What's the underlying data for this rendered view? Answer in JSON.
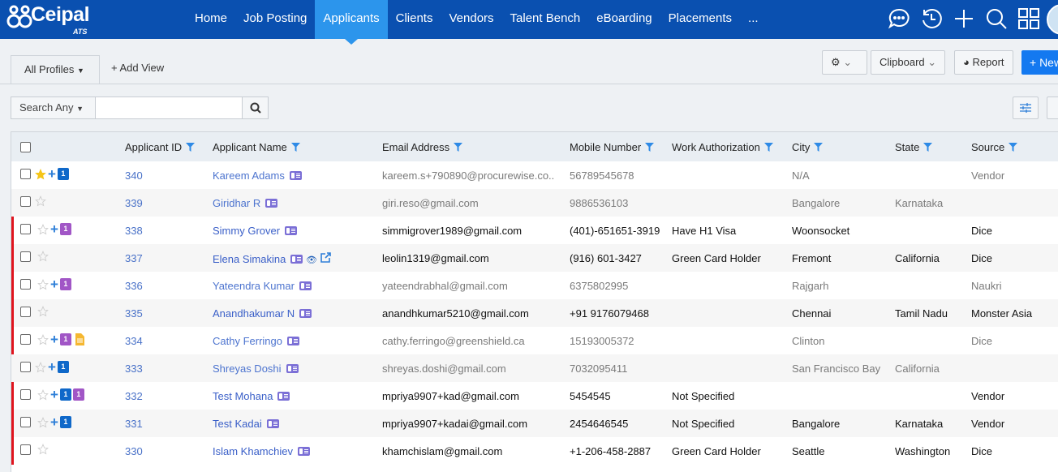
{
  "brand": {
    "name": "Ceipal",
    "sub": "ATS"
  },
  "nav": {
    "items": [
      "Home",
      "Job Posting",
      "Applicants",
      "Clients",
      "Vendors",
      "Talent Bench",
      "eBoarding",
      "Placements",
      "..."
    ],
    "active": "Applicants",
    "icons": [
      "chat-icon",
      "history-icon",
      "plus-icon",
      "search-icon",
      "apps-grid-icon"
    ]
  },
  "toolbar": {
    "tab": "All Profiles",
    "add_view": "+ Add View",
    "clipboard": "Clipboard",
    "report": "Report",
    "new": "+ New"
  },
  "search": {
    "select": "Search Any",
    "value": ""
  },
  "colors": {
    "nav": "#0a50b0",
    "active": "#2c95ec",
    "flag": "#e0141e",
    "primary": "#1479f0"
  },
  "table": {
    "columns": [
      "Applicant ID",
      "Applicant Name",
      "Email Address",
      "Mobile Number",
      "Work Authorization",
      "City",
      "State",
      "Source"
    ],
    "rows": [
      {
        "id": "340",
        "name": "Kareem Adams",
        "email": "kareem.s+790890@procurewise.co..",
        "mobile": "56789545678",
        "auth": "",
        "city": "N/A",
        "state": "",
        "source": "Vendor",
        "viewed": true,
        "flag": false,
        "star": true,
        "plus": true,
        "badges": [
          "blue"
        ]
      },
      {
        "id": "339",
        "name": "Giridhar R",
        "email": "giri.reso@gmail.com",
        "mobile": "9886536103",
        "auth": "",
        "city": "Bangalore",
        "state": "Karnataka",
        "source": "",
        "viewed": true,
        "flag": false,
        "star": false,
        "plus": false,
        "badges": []
      },
      {
        "id": "338",
        "name": "Simmy Grover",
        "email": "simmigrover1989@gmail.com",
        "mobile": "(401)-651651-3919",
        "auth": "Have H1 Visa",
        "city": "Woonsocket",
        "state": "",
        "source": "Dice",
        "viewed": false,
        "flag": true,
        "star": false,
        "plus": true,
        "badges": [
          "purple"
        ]
      },
      {
        "id": "337",
        "name": "Elena Simakina",
        "email": "leolin1319@gmail.com",
        "mobile": "(916) 601-3427",
        "auth": "Green Card Holder",
        "city": "Fremont",
        "state": "California",
        "source": "Dice",
        "viewed": false,
        "flag": true,
        "star": false,
        "plus": false,
        "badges": [],
        "extra": true
      },
      {
        "id": "336",
        "name": "Yateendra Kumar",
        "email": "yateendrabhal@gmail.com",
        "mobile": "6375802995",
        "auth": "",
        "city": "Rajgarh",
        "state": "",
        "source": "Naukri",
        "viewed": true,
        "flag": true,
        "star": false,
        "plus": true,
        "badges": [
          "purple"
        ]
      },
      {
        "id": "335",
        "name": "Anandhakumar N",
        "email": "anandhkumar5210@gmail.com",
        "mobile": "+91 9176079468",
        "auth": "",
        "city": "Chennai",
        "state": "Tamil Nadu",
        "source": "Monster Asia",
        "viewed": false,
        "flag": true,
        "star": false,
        "plus": false,
        "badges": []
      },
      {
        "id": "334",
        "name": "Cathy Ferringo",
        "email": "cathy.ferringo@greenshield.ca",
        "mobile": "15193005372",
        "auth": "",
        "city": "Clinton",
        "state": "",
        "source": "Dice",
        "viewed": true,
        "flag": true,
        "star": false,
        "plus": true,
        "badges": [
          "purple"
        ],
        "doc": true
      },
      {
        "id": "333",
        "name": "Shreyas Doshi",
        "email": "shreyas.doshi@gmail.com",
        "mobile": "7032095411",
        "auth": "",
        "city": "San Francisco Bay",
        "state": "California",
        "source": "",
        "viewed": true,
        "flag": false,
        "star": false,
        "plus": true,
        "badges": [
          "blue"
        ]
      },
      {
        "id": "332",
        "name": "Test Mohana",
        "email": "mpriya9907+kad@gmail.com",
        "mobile": "5454545",
        "auth": "Not Specified",
        "city": "",
        "state": "",
        "source": "Vendor",
        "viewed": false,
        "flag": true,
        "star": false,
        "plus": true,
        "badges": [
          "blue",
          "purple"
        ]
      },
      {
        "id": "331",
        "name": "Test Kadai",
        "email": "mpriya9907+kadai@gmail.com",
        "mobile": "2454646545",
        "auth": "Not Specified",
        "city": "Bangalore",
        "state": "Karnataka",
        "source": "Vendor",
        "viewed": false,
        "flag": true,
        "star": false,
        "plus": true,
        "badges": [
          "blue"
        ]
      },
      {
        "id": "330",
        "name": "Islam Khamchiev",
        "email": "khamchislam@gmail.com",
        "mobile": "+1-206-458-2887",
        "auth": "Green Card Holder",
        "city": "Seattle",
        "state": "Washington",
        "source": "Dice",
        "viewed": false,
        "flag": true,
        "star": false,
        "plus": false,
        "badges": []
      }
    ],
    "badge_count": "1"
  }
}
